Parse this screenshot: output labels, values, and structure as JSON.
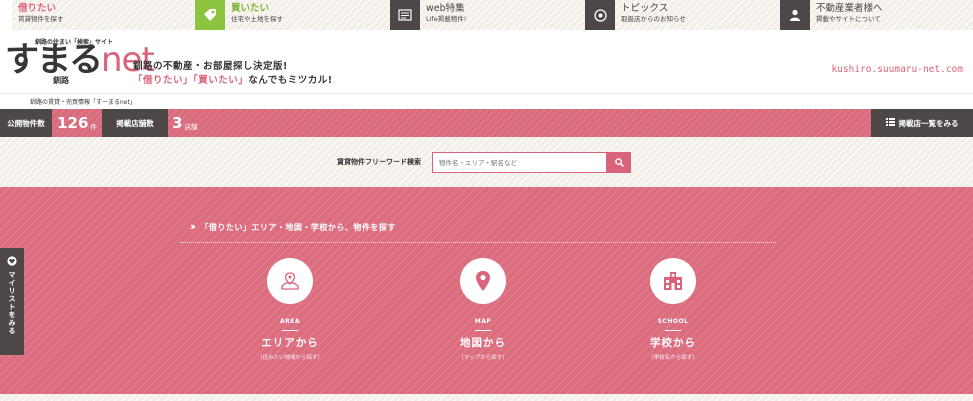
{
  "nav": {
    "items": [
      {
        "title": "借りたい",
        "subtitle": "賃貸物件を探す"
      },
      {
        "title": "買いたい",
        "subtitle": "住宅や土地を探す"
      },
      {
        "title": "web特集",
        "subtitle": "Life掲載物件!"
      },
      {
        "title": "トピックス",
        "subtitle": "取扱店からのお知らせ"
      },
      {
        "title": "不動産業者様へ",
        "subtitle": "掲載やサイトについて"
      }
    ]
  },
  "header": {
    "logo_tagline": "釧路の住まい「検索」サイト",
    "logo_text_jp": "すまる",
    "logo_text_net": "net",
    "logo_sub": "釧路",
    "catch_line1": "釧路の不動産・お部屋探し決定版!",
    "catch_line2_part1": "「借りたい」",
    "catch_line2_part2": "「買いたい」",
    "catch_line2_part3": "なんでもミツカル!",
    "site_url": "kushiro.suumaru-net.com"
  },
  "breadcrumb": "釧路の賃貸・売買情報「すーまるnet」",
  "stats": {
    "listings_label": "公開物件数",
    "listings_count": "126",
    "listings_unit": "件",
    "stores_label": "掲載店舗数",
    "stores_count": "3",
    "stores_unit": "店舗",
    "storelist_button": "掲載店一覧をみる"
  },
  "search": {
    "label": "賃貸物件フリーワード検索",
    "placeholder": "物件名・エリア・駅名など"
  },
  "section": {
    "title": "「借りたい」エリア・地図・学校から、物件を探す",
    "cards": [
      {
        "en": "AREA",
        "jp": "エリアから",
        "sub": "〔住みたい地域から探す〕"
      },
      {
        "en": "MAP",
        "jp": "地図から",
        "sub": "〔マップから探す〕"
      },
      {
        "en": "SCHOOL",
        "jp": "学校から",
        "sub": "〔学校名から探す〕"
      }
    ]
  },
  "side_tab": {
    "label": "マイリストをみる"
  },
  "colors": {
    "accent": "#d9637a",
    "dark": "#4e4747",
    "green": "#8dc43f"
  }
}
